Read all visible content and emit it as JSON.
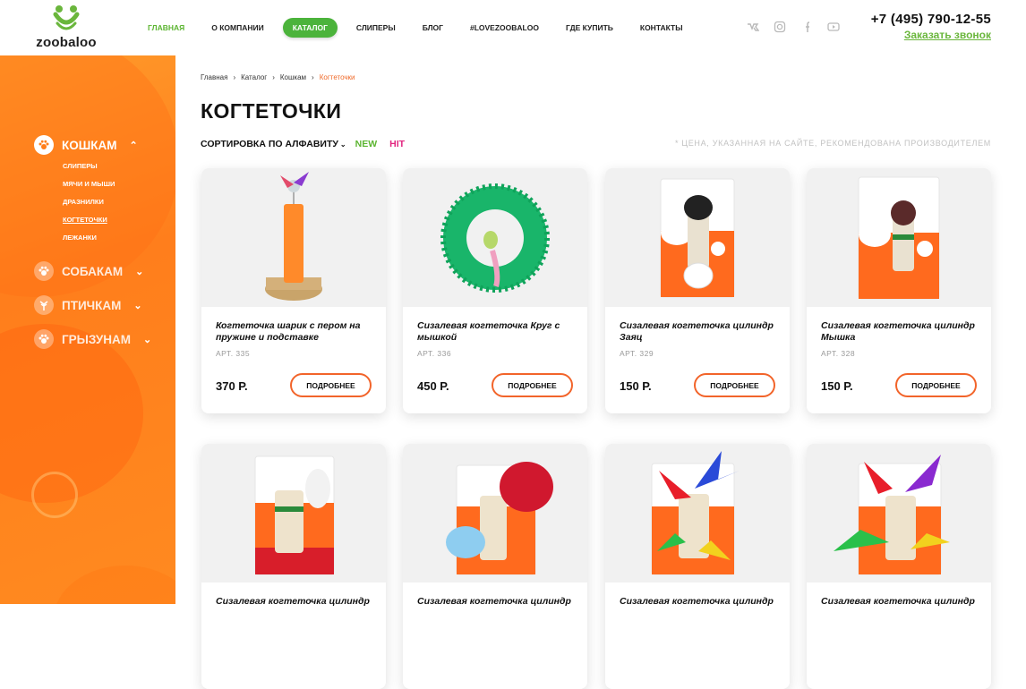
{
  "brand": {
    "logo_text": "zoobaloo"
  },
  "nav": [
    {
      "label": "Главная"
    },
    {
      "label": "О компании"
    },
    {
      "label": "Каталог"
    },
    {
      "label": "Слиперы"
    },
    {
      "label": "Блог"
    },
    {
      "label": "#lovezoobaloo"
    },
    {
      "label": "Где купить"
    },
    {
      "label": "Контакты"
    }
  ],
  "social": [
    "vk-icon",
    "instagram-icon",
    "facebook-icon",
    "youtube-icon"
  ],
  "contact": {
    "phone": "+7 (495) 790-12-55",
    "callback": "Заказать звонок"
  },
  "sidebar": {
    "categories": [
      {
        "label": "Кошкам",
        "icon": "paw-icon",
        "expanded": true
      },
      {
        "label": "Собакам",
        "icon": "paw-icon"
      },
      {
        "label": "Птичкам",
        "icon": "bird-icon"
      },
      {
        "label": "Грызунам",
        "icon": "paw-icon"
      }
    ],
    "cats_sub": [
      "Слиперы",
      "Мячи и мыши",
      "Дразнилки",
      "Когтеточки",
      "Лежанки"
    ]
  },
  "breadcrumb": [
    "Главная",
    "Каталог",
    "Кошкам",
    "Когтеточки"
  ],
  "page": {
    "title": "КОГТЕТОЧКИ",
    "sort_label": "Сортировка по алфавиту",
    "filter_new": "NEW",
    "filter_hit": "HIT",
    "note": "* Цена, указанная на сайте, рекомендована производителем"
  },
  "products": [
    {
      "name": "Когтеточка шарик с пером на пружине и подставке",
      "art": "АРТ. 335",
      "price": "370 Р.",
      "button": "Подробнее"
    },
    {
      "name": "Сизалевая когтеточка Круг с мышкой",
      "art": "АРТ. 336",
      "price": "450 Р.",
      "button": "Подробнее"
    },
    {
      "name": "Сизалевая когтеточка цилиндр Заяц",
      "art": "АРТ. 329",
      "price": "150 Р.",
      "button": "Подробнее"
    },
    {
      "name": "Сизалевая когтеточка цилиндр Мышка",
      "art": "АРТ. 328",
      "price": "150 Р.",
      "button": "Подробнее"
    },
    {
      "name": "Сизалевая когтеточка цилиндр"
    },
    {
      "name": "Сизалевая когтеточка цилиндр"
    },
    {
      "name": "Сизалевая когтеточка цилиндр"
    },
    {
      "name": "Сизалевая когтеточка цилиндр"
    }
  ]
}
